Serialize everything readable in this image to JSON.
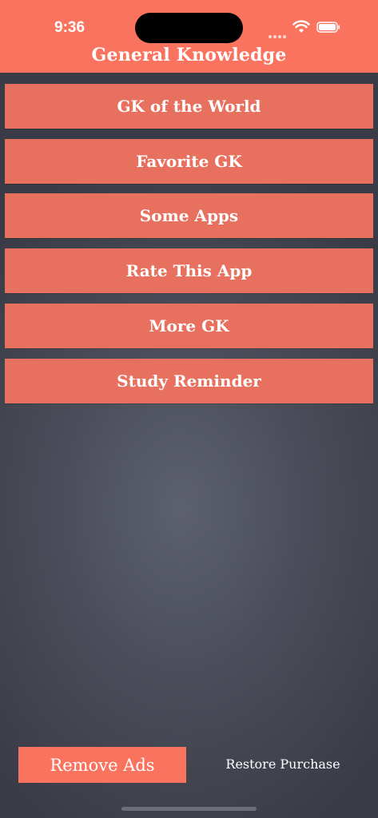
{
  "status_bar": {
    "time": "9:36"
  },
  "header": {
    "title": "General Knowledge"
  },
  "menu": [
    {
      "label": "GK of the World"
    },
    {
      "label": "Favorite GK"
    },
    {
      "label": "Some Apps"
    },
    {
      "label": "Rate This App"
    },
    {
      "label": "More GK"
    },
    {
      "label": "Study Reminder"
    }
  ],
  "footer": {
    "remove_ads": "Remove Ads",
    "restore_purchase": "Restore Purchase"
  },
  "colors": {
    "accent": "#fa735e",
    "button": "#e8705f",
    "background": "#4b4e5a"
  },
  "icons": [
    "signal-dots-icon",
    "wifi-icon",
    "battery-icon"
  ]
}
